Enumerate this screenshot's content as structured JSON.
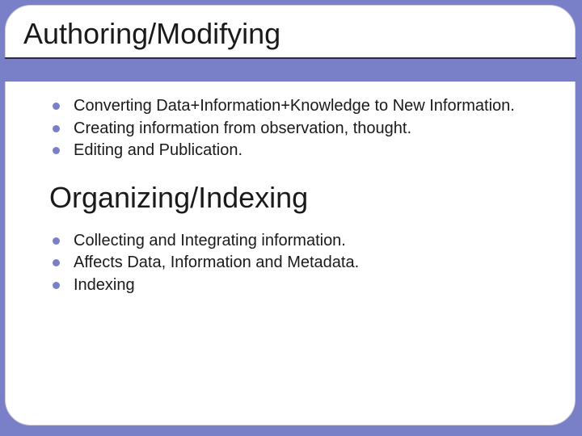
{
  "slide": {
    "title": "Authoring/Modifying",
    "section1": {
      "items": [
        "Converting Data+Information+Knowledge to New Information.",
        "Creating information from observation, thought.",
        "Editing and Publication."
      ]
    },
    "subtitle": "Organizing/Indexing",
    "section2": {
      "items": [
        "Collecting and Integrating information.",
        "Affects Data, Information and Metadata.",
        "Indexing"
      ]
    }
  }
}
